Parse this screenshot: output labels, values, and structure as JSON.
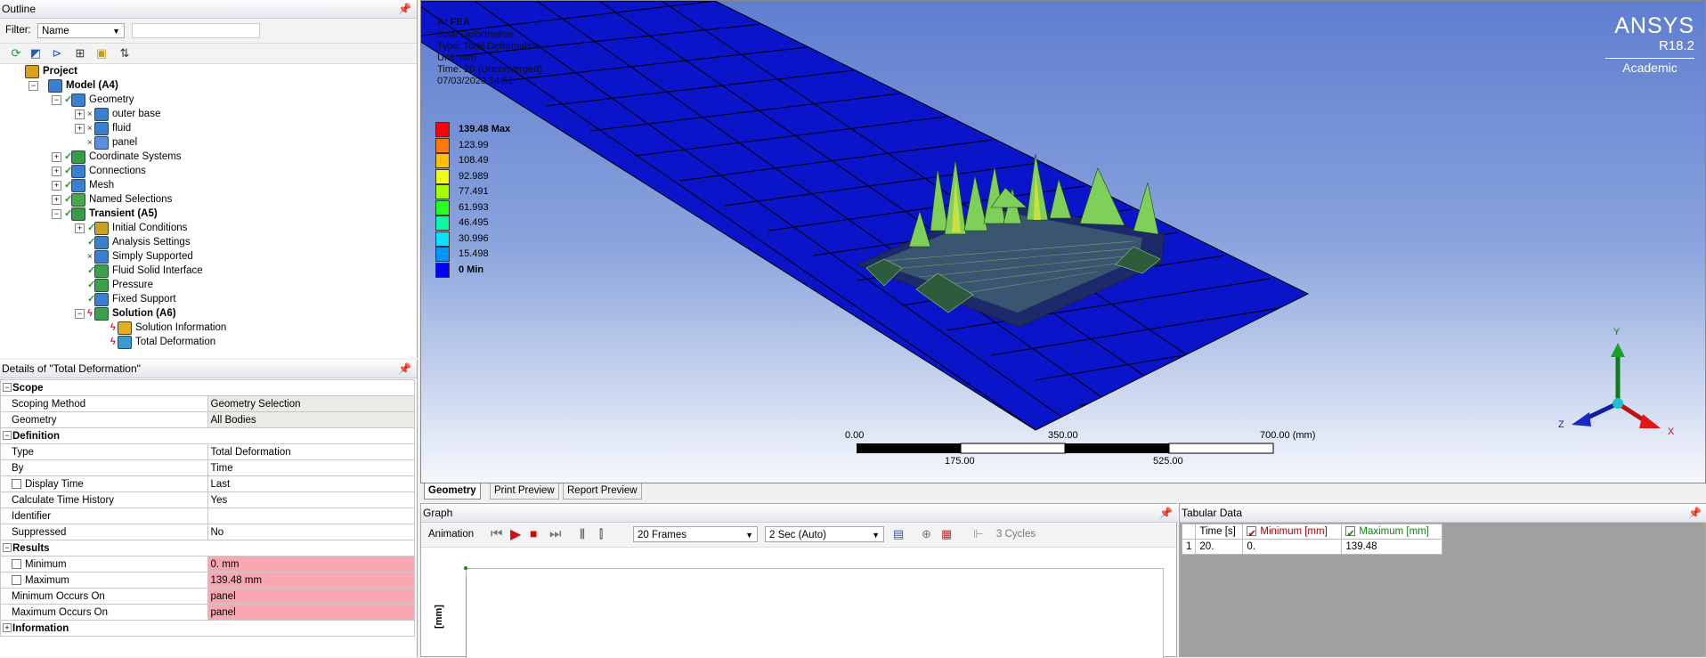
{
  "outline": {
    "title": "Outline",
    "filter_label": "Filter:",
    "filter_value": "Name",
    "filter_text": "",
    "tree": [
      {
        "label": "Project",
        "bold": true,
        "indent": 0,
        "expander": "",
        "status": "",
        "icon_color": "#d9a21b"
      },
      {
        "label": "Model (A4)",
        "bold": true,
        "indent": 1,
        "expander": "−",
        "status": "",
        "icon_color": "#3b7fd1"
      },
      {
        "label": "Geometry",
        "bold": false,
        "indent": 2,
        "expander": "−",
        "status": "check",
        "icon_color": "#3b7fd1"
      },
      {
        "label": "outer base",
        "bold": false,
        "indent": 3,
        "expander": "+",
        "status": "x",
        "icon_color": "#3b7fd1"
      },
      {
        "label": "fluid",
        "bold": false,
        "indent": 3,
        "expander": "+",
        "status": "x",
        "icon_color": "#3b7fd1"
      },
      {
        "label": "panel",
        "bold": false,
        "indent": 3,
        "expander": "",
        "status": "x",
        "icon_color": "#5a8fe0"
      },
      {
        "label": "Coordinate Systems",
        "bold": false,
        "indent": 2,
        "expander": "+",
        "status": "check",
        "icon_color": "#3a9a4a"
      },
      {
        "label": "Connections",
        "bold": false,
        "indent": 2,
        "expander": "+",
        "status": "check",
        "icon_color": "#3b7fd1"
      },
      {
        "label": "Mesh",
        "bold": false,
        "indent": 2,
        "expander": "+",
        "status": "check",
        "icon_color": "#3b7fd1"
      },
      {
        "label": "Named Selections",
        "bold": false,
        "indent": 2,
        "expander": "+",
        "status": "check",
        "icon_color": "#4aa84a"
      },
      {
        "label": "Transient (A5)",
        "bold": true,
        "indent": 2,
        "expander": "−",
        "status": "check",
        "icon_color": "#3a9a4a"
      },
      {
        "label": "Initial Conditions",
        "bold": false,
        "indent": 3,
        "expander": "+",
        "status": "check",
        "icon_color": "#c8a224"
      },
      {
        "label": "Analysis Settings",
        "bold": false,
        "indent": 3,
        "expander": "",
        "status": "check",
        "icon_color": "#3b7fd1"
      },
      {
        "label": "Simply Supported",
        "bold": false,
        "indent": 3,
        "expander": "",
        "status": "x",
        "icon_color": "#3b7fd1"
      },
      {
        "label": "Fluid Solid Interface",
        "bold": false,
        "indent": 3,
        "expander": "",
        "status": "check",
        "icon_color": "#3aa04a"
      },
      {
        "label": "Pressure",
        "bold": false,
        "indent": 3,
        "expander": "",
        "status": "check",
        "icon_color": "#3aa04a"
      },
      {
        "label": "Fixed Support",
        "bold": false,
        "indent": 3,
        "expander": "",
        "status": "check",
        "icon_color": "#3b7fd1"
      },
      {
        "label": "Solution (A6)",
        "bold": true,
        "indent": 3,
        "expander": "−",
        "status": "bolt",
        "icon_color": "#3aa04a"
      },
      {
        "label": "Solution Information",
        "bold": false,
        "indent": 4,
        "expander": "",
        "status": "bolt",
        "icon_color": "#e0b020"
      },
      {
        "label": "Total Deformation",
        "bold": false,
        "indent": 4,
        "expander": "",
        "status": "bolt",
        "icon_color": "#3b9ad0"
      }
    ]
  },
  "details": {
    "title": "Details of \"Total Deformation\"",
    "rows": [
      {
        "kind": "group",
        "label": "Scope",
        "sign": "−"
      },
      {
        "kind": "prop",
        "label": "Scoping Method",
        "value": "Geometry Selection",
        "style": "grey",
        "checkbox": false
      },
      {
        "kind": "prop",
        "label": "Geometry",
        "value": "All Bodies",
        "style": "grey",
        "checkbox": false
      },
      {
        "kind": "group",
        "label": "Definition",
        "sign": "−"
      },
      {
        "kind": "prop",
        "label": "Type",
        "value": "Total Deformation",
        "style": "",
        "checkbox": false
      },
      {
        "kind": "prop",
        "label": "By",
        "value": "Time",
        "style": "",
        "checkbox": false
      },
      {
        "kind": "prop",
        "label": "Display Time",
        "value": "Last",
        "style": "",
        "checkbox": true
      },
      {
        "kind": "prop",
        "label": "Calculate Time History",
        "value": "Yes",
        "style": "",
        "checkbox": false
      },
      {
        "kind": "prop",
        "label": "Identifier",
        "value": "",
        "style": "",
        "checkbox": false
      },
      {
        "kind": "prop",
        "label": "Suppressed",
        "value": "No",
        "style": "",
        "checkbox": false
      },
      {
        "kind": "group",
        "label": "Results",
        "sign": "−"
      },
      {
        "kind": "prop",
        "label": "Minimum",
        "value": "0. mm",
        "style": "red",
        "checkbox": true
      },
      {
        "kind": "prop",
        "label": "Maximum",
        "value": "139.48 mm",
        "style": "red",
        "checkbox": true
      },
      {
        "kind": "prop",
        "label": "Minimum Occurs On",
        "value": "panel",
        "style": "red",
        "checkbox": false
      },
      {
        "kind": "prop",
        "label": "Maximum Occurs On",
        "value": "panel",
        "style": "red",
        "checkbox": false
      },
      {
        "kind": "group",
        "label": "Information",
        "sign": "+"
      }
    ]
  },
  "viewport": {
    "info_title": "A: FEA",
    "info_lines": [
      "Total Deformation",
      "Type: Total Deformation",
      "Unit: mm",
      "Time: 20 (Unconverged)",
      "07/03/2020 14:51"
    ],
    "legend": [
      {
        "label": "139.48 Max",
        "color": "#ff0000",
        "bold": true
      },
      {
        "label": "123.99",
        "color": "#ff7a00",
        "bold": false
      },
      {
        "label": "108.49",
        "color": "#ffc000",
        "bold": false
      },
      {
        "label": "92.989",
        "color": "#f2ff00",
        "bold": false
      },
      {
        "label": "77.491",
        "color": "#a6ff00",
        "bold": false
      },
      {
        "label": "61.993",
        "color": "#28ff20",
        "bold": false
      },
      {
        "label": "46.495",
        "color": "#00ffa0",
        "bold": false
      },
      {
        "label": "30.996",
        "color": "#00e4ff",
        "bold": false
      },
      {
        "label": "15.498",
        "color": "#0094ff",
        "bold": false
      },
      {
        "label": "0 Min",
        "color": "#0000ff",
        "bold": true
      }
    ],
    "brand": {
      "name": "ANSYS",
      "version": "R18.2",
      "edition": "Academic"
    },
    "scale": {
      "top_labels": [
        "0.00",
        "350.00",
        "700.00 (mm)"
      ],
      "bottom_labels": [
        "175.00",
        "525.00"
      ]
    },
    "axes": {
      "y": "Y",
      "x": "X",
      "z": "Z"
    },
    "colors": {
      "mesh_blue": "#0a14c8",
      "grid_line": "#000000"
    }
  },
  "view_tabs": [
    "Geometry",
    "Print Preview",
    "Report Preview"
  ],
  "graph": {
    "title": "Graph",
    "animation_label": "Animation",
    "frames": "20 Frames",
    "duration": "2 Sec (Auto)",
    "cycles": "3 Cycles",
    "y_label": "[mm]"
  },
  "tabular": {
    "title": "Tabular Data",
    "headers": [
      "Time [s]",
      "Minimum [mm]",
      "Maximum [mm]"
    ],
    "header_colors": [
      "#000000",
      "#b00000",
      "#0a8a0a"
    ],
    "rows": [
      {
        "index": "1",
        "cells": [
          "20.",
          "0.",
          "139.48"
        ]
      }
    ]
  }
}
